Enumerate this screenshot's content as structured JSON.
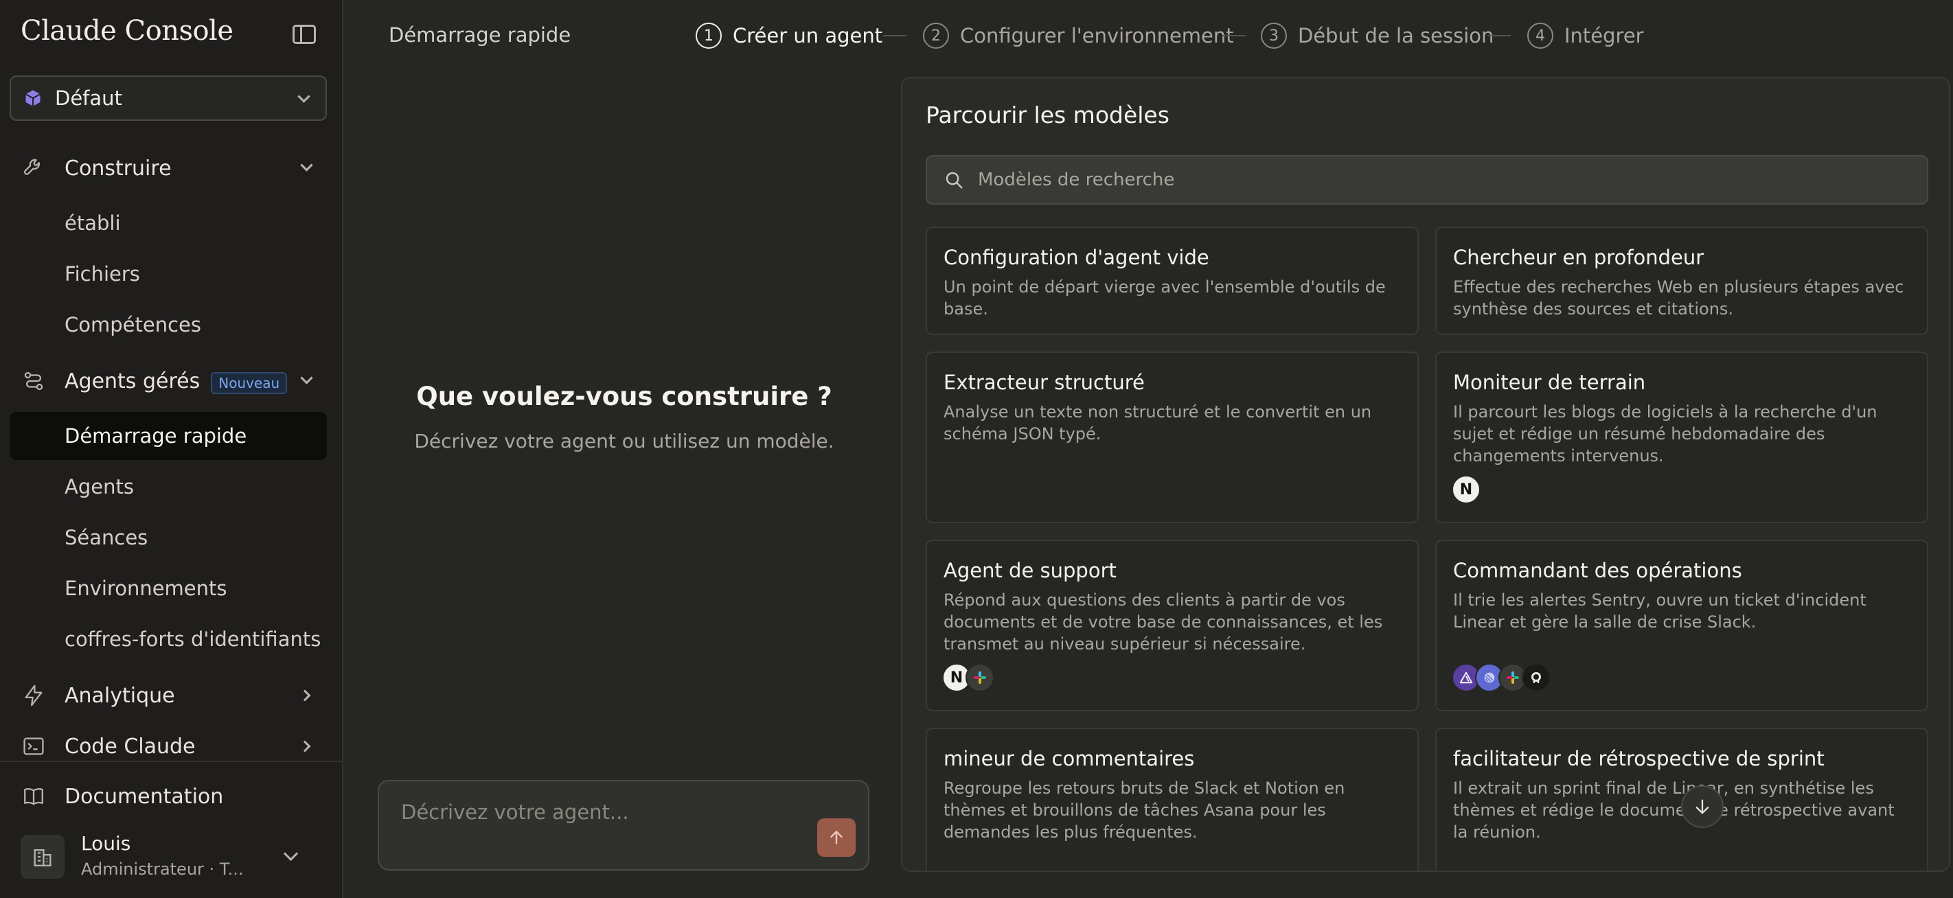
{
  "app": {
    "brand": "Claude Console"
  },
  "workspace": {
    "name": "Défaut"
  },
  "sidebar": {
    "build": {
      "label": "Construire",
      "items": [
        {
          "label": "établi"
        },
        {
          "label": "Fichiers"
        },
        {
          "label": "Compétences"
        }
      ]
    },
    "managed_agents": {
      "label": "Agents gérés",
      "badge": "Nouveau",
      "items": [
        {
          "label": "Démarrage rapide",
          "active": true
        },
        {
          "label": "Agents"
        },
        {
          "label": "Séances"
        },
        {
          "label": "Environnements"
        },
        {
          "label": "coffres-forts d'identifiants"
        }
      ]
    },
    "analytics": {
      "label": "Analytique"
    },
    "claude_code": {
      "label": "Code Claude"
    },
    "documentation": {
      "label": "Documentation"
    }
  },
  "user": {
    "name": "Louis",
    "role": "Administrateur · T..."
  },
  "header": {
    "page_title": "Démarrage rapide",
    "steps": [
      {
        "num": "1",
        "label": "Créer un agent",
        "active": true
      },
      {
        "num": "2",
        "label": "Configurer l'environnement"
      },
      {
        "num": "3",
        "label": "Début de la session"
      },
      {
        "num": "4",
        "label": "Intégrer"
      }
    ]
  },
  "prompt": {
    "heading": "Que voulez-vous construire ?",
    "subheading": "Décrivez votre agent ou utilisez un modèle.",
    "input_placeholder": "Décrivez votre agent..."
  },
  "templates": {
    "title": "Parcourir les modèles",
    "search_placeholder": "Modèles de recherche",
    "cards": [
      {
        "title": "Configuration d'agent vide",
        "desc": "Un point de départ vierge avec l'ensemble d'outils de base.",
        "icons": []
      },
      {
        "title": "Chercheur en profondeur",
        "desc": "Effectue des recherches Web en plusieurs étapes avec synthèse des sources et citations.",
        "icons": []
      },
      {
        "title": "Extracteur structuré",
        "desc": "Analyse un texte non structuré et le convertit en un schéma JSON typé.",
        "icons": []
      },
      {
        "title": "Moniteur de terrain",
        "desc": "Il parcourt les blogs de logiciels à la recherche d'un sujet et rédige un résumé hebdomadaire des changements intervenus.",
        "icons": [
          "notion-icon"
        ]
      },
      {
        "title": "Agent de support",
        "desc": "Répond aux questions des clients à partir de vos documents et de votre base de connaissances, et les transmet au niveau supérieur si nécessaire.",
        "icons": [
          "notion-icon",
          "slack-icon"
        ]
      },
      {
        "title": "Commandant des opérations",
        "desc": "Il trie les alertes Sentry, ouvre un ticket d'incident Linear et gère la salle de crise Slack.",
        "icons": [
          "sentry-icon",
          "linear-icon",
          "slack-icon",
          "github-icon"
        ]
      },
      {
        "title": "mineur de commentaires",
        "desc": "Regroupe les retours bruts de Slack et Notion en thèmes et brouillons de tâches Asana pour les demandes les plus fréquentes.",
        "icons": []
      },
      {
        "title": "facilitateur de rétrospective de sprint",
        "desc": "Il extrait un sprint final de Linear, en synthétise les thèmes et rédige le document de rétrospective avant la réunion.",
        "icons": []
      }
    ]
  },
  "colors": {
    "accent_send": "#9a5a48",
    "badge_blue": "#7aa7f0",
    "cube_purple": "#8f7ee8"
  }
}
